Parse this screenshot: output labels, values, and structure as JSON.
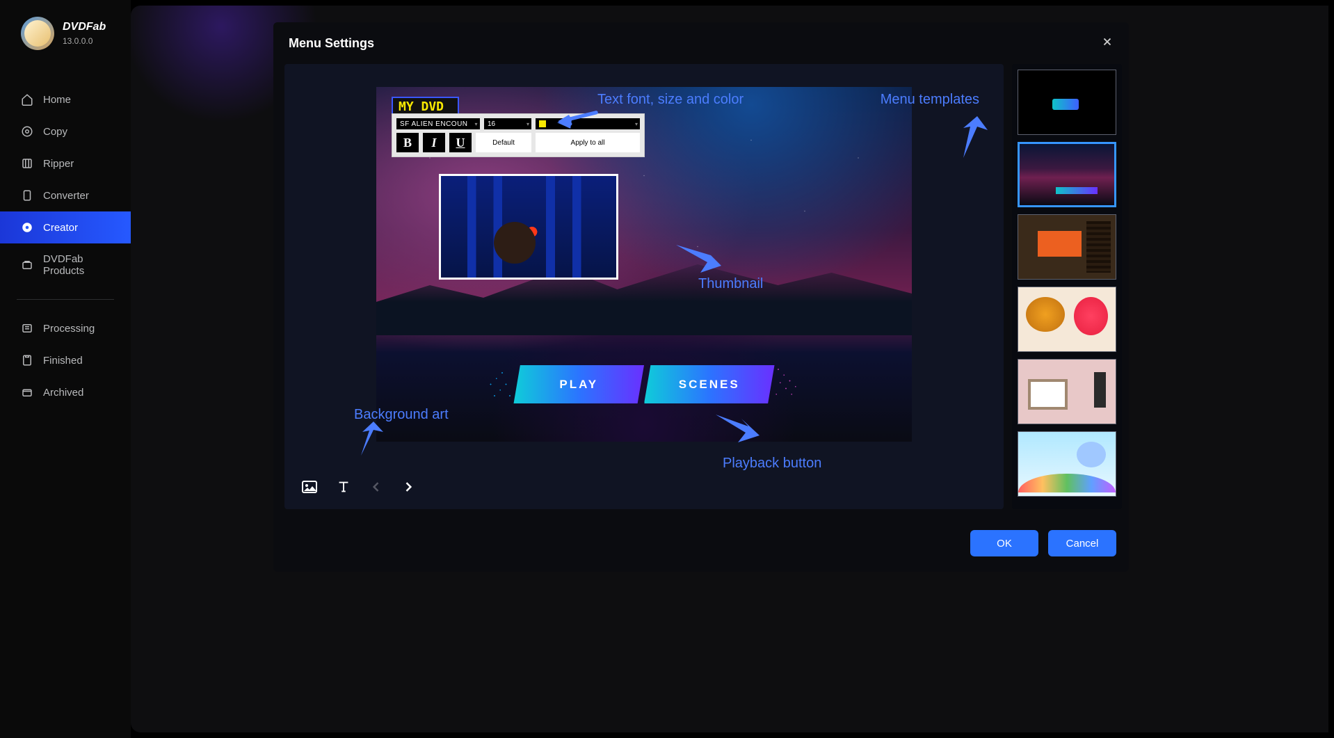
{
  "brand": {
    "name": "DVDFab",
    "version": "13.0.0.0"
  },
  "sidebar": {
    "items": [
      {
        "label": "Home"
      },
      {
        "label": "Copy"
      },
      {
        "label": "Ripper"
      },
      {
        "label": "Converter"
      },
      {
        "label": "Creator"
      },
      {
        "label": "DVDFab Products"
      }
    ],
    "items2": [
      {
        "label": "Processing"
      },
      {
        "label": "Finished"
      },
      {
        "label": "Archived"
      }
    ],
    "active_index": 4
  },
  "modal": {
    "title": "Menu Settings"
  },
  "dvd": {
    "title": "MY DVD",
    "toolbar": {
      "font": "SF ALIEN ENCOUN",
      "size": "16",
      "bold": "B",
      "italic": "I",
      "underline": "U",
      "default": "Default",
      "apply_all": "Apply to all"
    },
    "buttons": {
      "play": "PLAY",
      "scenes": "SCENES"
    }
  },
  "templates": {
    "count": 6,
    "selected_index": 1
  },
  "footer": {
    "ok": "OK",
    "cancel": "Cancel"
  },
  "annotations": {
    "text_controls": "Text font, size and color",
    "menu_templates": "Menu templates",
    "thumbnail": "Thumbnail",
    "background": "Background art",
    "playback": "Playback button"
  },
  "colors": {
    "accent": "#2b73ff",
    "annotation": "#4c7dff",
    "dvd_title": "#f9e901"
  }
}
